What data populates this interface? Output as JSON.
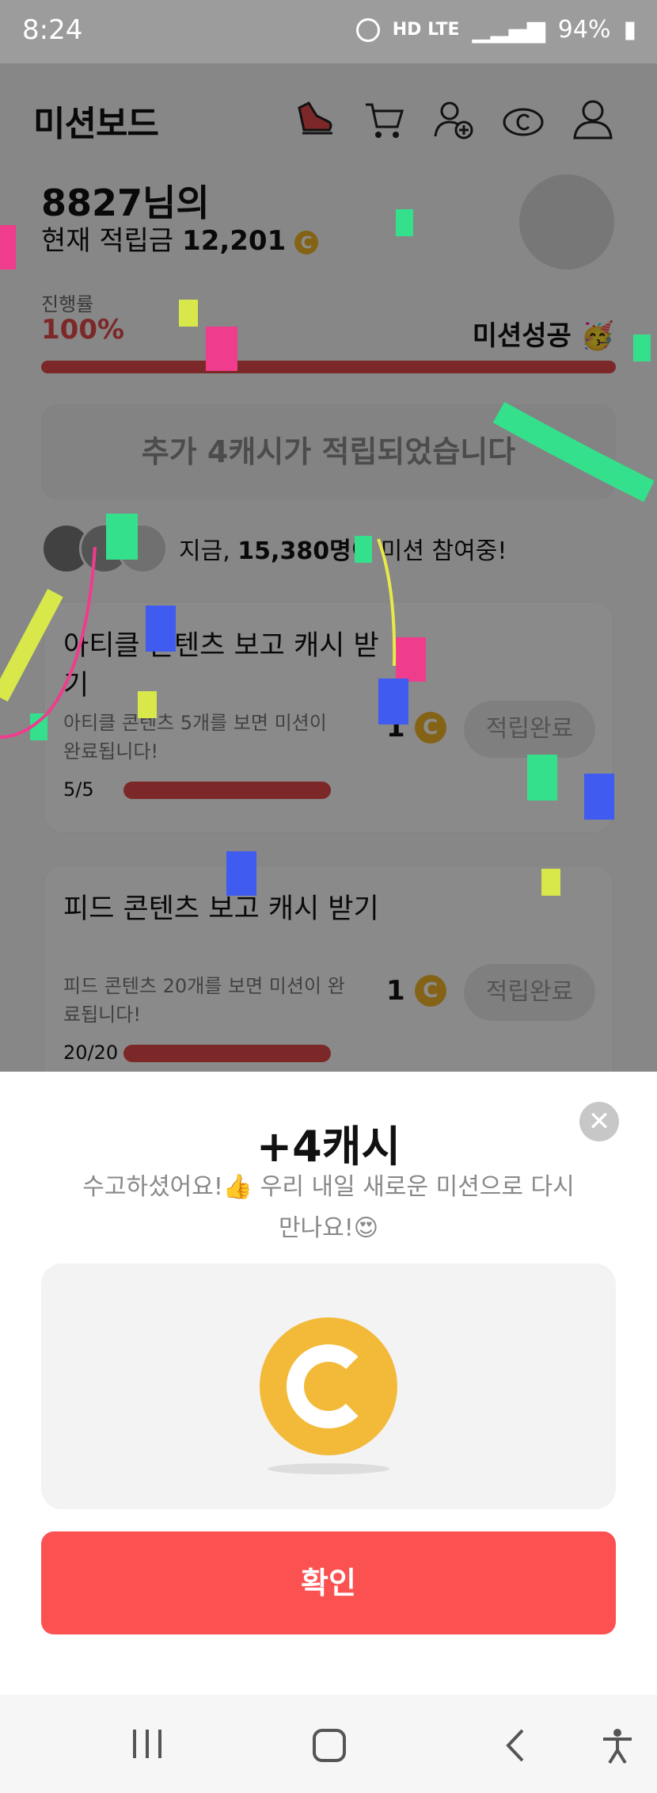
{
  "status_bar": {
    "time": "8:24",
    "network": "HD LTE",
    "battery": "94%"
  },
  "header": {
    "brand": "미션보드"
  },
  "profile": {
    "greeting": "8827님의",
    "balance_label": "현재 적립금",
    "balance_value": "12,201",
    "progress_label": "진행률",
    "progress_value": "100%",
    "progress_fraction": 1.0,
    "mission_status": "미션성공 🥳"
  },
  "banner": {
    "text": "추가 4캐시가 적립되었습니다"
  },
  "participants": {
    "prefix": "지금,",
    "count": "15,380명",
    "suffix": "이 미션 참여중!"
  },
  "missions": [
    {
      "title": "아티클 콘텐츠 보고 캐시 받기",
      "desc": "아티클 콘텐츠 5개를 보면 미션이 완료됩니다!",
      "count": "5/5",
      "reward": "1",
      "status": "적립완료"
    },
    {
      "title": "피드 콘텐츠 보고 캐시 받기",
      "desc": "피드 콘텐츠 20개를 보면 미션이 완료됩니다!",
      "count": "20/20",
      "reward": "1",
      "status": "적립완료"
    }
  ],
  "sheet": {
    "title": "+4캐시",
    "message": "수고하셨어요!👍 우리 내일 새로운 미션으로 다시 만나요!😍",
    "confirm": "확인",
    "close_icon": "close-icon"
  },
  "coin_symbol": "C",
  "colors": {
    "accent": "#fb5151",
    "coin": "#f2ba38",
    "progress": "#e24a4a"
  }
}
